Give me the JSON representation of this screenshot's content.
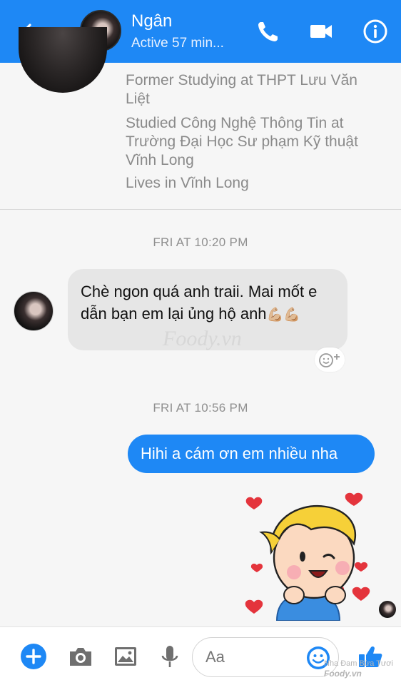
{
  "header": {
    "contact_name": "Ngân",
    "status": "Active 57 min...",
    "icons": [
      "back-arrow-icon",
      "phone-icon",
      "video-camera-icon",
      "info-icon"
    ]
  },
  "profile": {
    "lines": [
      "Former Studying at THPT Lưu Văn Liệt",
      "Studied Công Nghệ Thông Tin at Trường Đại Học Sư phạm Kỹ thuật Vĩnh Long",
      "Lives in Vĩnh Long"
    ]
  },
  "conversation": {
    "timestamp_1": "FRI AT 10:20 PM",
    "incoming_text": "Chè ngon quá anh traii. Mai mốt e dẫn bạn em lại ủng hộ anh",
    "incoming_emoji": "💪🏼💪🏼",
    "watermark": "Foody.vn",
    "timestamp_2": "FRI AT 10:56 PM",
    "outgoing_text": "Hihi a cám ơn em nhiều nha",
    "sticker": "boy-winking-hearts-sticker"
  },
  "composer": {
    "placeholder": "Aa",
    "icons": [
      "plus-icon",
      "camera-icon",
      "image-icon",
      "microphone-icon",
      "emoji-icon",
      "thumbs-up-icon"
    ]
  },
  "footer_watermark": {
    "line1": "Nha Đam Bừa Tươi",
    "line2": "Foody.vn"
  },
  "colors": {
    "brand_blue": "#1e88f5",
    "incoming_bubble": "#e6e6e6",
    "background": "#f6f6f6"
  }
}
